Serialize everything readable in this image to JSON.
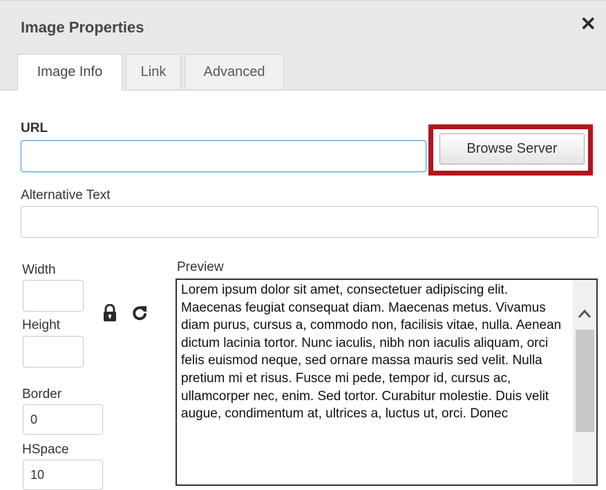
{
  "dialog": {
    "title": "Image Properties",
    "close_glyph": "✕"
  },
  "tabs": [
    {
      "label": "Image Info",
      "active": true
    },
    {
      "label": "Link",
      "active": false
    },
    {
      "label": "Advanced",
      "active": false
    }
  ],
  "fields": {
    "url_label": "URL",
    "url_value": "",
    "browse_label": "Browse Server",
    "alt_label": "Alternative Text",
    "alt_value": "",
    "width_label": "Width",
    "width_value": "",
    "height_label": "Height",
    "height_value": "",
    "border_label": "Border",
    "border_value": "0",
    "hspace_label": "HSpace",
    "hspace_value": "10"
  },
  "icons": {
    "lock": "lock-icon",
    "reset": "reset-size-icon",
    "scroll_up": "chevron-up-icon"
  },
  "preview": {
    "label": "Preview",
    "text": "Lorem ipsum dolor sit amet, consectetuer adipiscing elit. Maecenas feugiat consequat diam. Maecenas metus. Vivamus diam purus, cursus a, commodo non, facilisis vitae, nulla. Aenean dictum lacinia tortor. Nunc iaculis, nibh non iaculis aliquam, orci felis euismod neque, sed ornare massa mauris sed velit. Nulla pretium mi et risus. Fusce mi pede, tempor id, cursus ac, ullamcorper nec, enim. Sed tortor. Curabitur molestie. Duis velit augue, condimentum at, ultrices a, luctus ut, orci. Donec"
  },
  "colors": {
    "highlight": "#b3141c",
    "focus_border": "#4a9fe0"
  }
}
